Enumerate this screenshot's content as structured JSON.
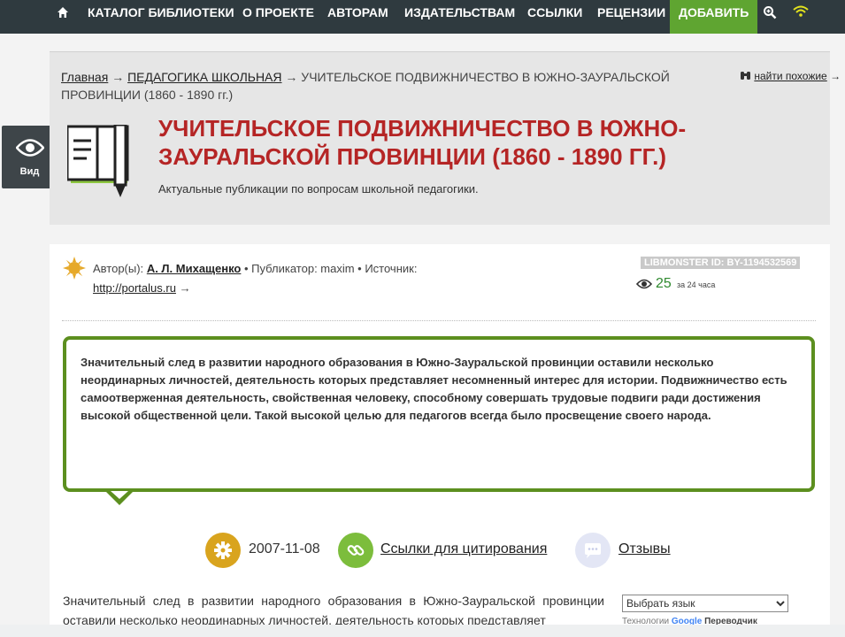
{
  "nav": {
    "items": [
      "КАТАЛОГ БИБЛИОТЕКИ",
      "О ПРОЕКТЕ",
      "АВТОРАМ",
      "ИЗДАТЕЛЬСТВАМ",
      "ССЫЛКИ",
      "РЕЦЕНЗИИ"
    ],
    "add_label": "ДОБАВИТЬ"
  },
  "breadcrumb": {
    "home": "Главная",
    "section": "ПЕДАГОГИКА ШКОЛЬНАЯ",
    "current": "УЧИТЕЛЬСКОЕ ПОДВИЖНИЧЕСТВО В ЮЖНО-ЗАУРАЛЬСКОЙ ПРОВИНЦИИ (1860 - 1890 гг.)"
  },
  "find_similar": "найти похожие",
  "title": "УЧИТЕЛЬСКОЕ ПОДВИЖНИЧЕСТВО В ЮЖНО-ЗАУРАЛЬСКОЙ ПРОВИНЦИИ (1860 - 1890 гг.)",
  "subtitle": "Актуальные публикации по вопросам школьной педагогики.",
  "view_label": "Вид",
  "author": {
    "label": "Автор(ы):",
    "name": "А. Л. Михащенко",
    "publisher": "• Публикатор: maxim • Источник:",
    "source": "http://portalus.ru"
  },
  "libmonster_id": "LIBMONSTER ID: BY-1194532569",
  "views": {
    "count": "25",
    "period": "за 24 часа"
  },
  "abstract": "Значительный след в развитии народного образования в Южно-Зауральской провинции оставили несколько неординарных личностей, деятельность которых представляет несомненный интерес для истории. Подвижничество есть самоотверженная деятельность, свойственная человеку, способному совершать трудовые подвиги ради достижения высокой общественной цели. Такой высокой целью для педагогов всегда было просвещение своего народа.",
  "meta": {
    "date": "2007-11-08",
    "cite_label": "Ссылки для цитирования",
    "reviews_label": "Отзывы"
  },
  "body_text": "Значительный след в развитии народного образования в Южно-Зауральской провинции оставили несколько неординарных личностей, деятельность которых представляет",
  "language": {
    "placeholder": "Выбрать язык",
    "powered_prefix": "Технологии",
    "powered_brand": "Google",
    "powered_product": "Переводчик"
  },
  "colors": {
    "nav_bg": "#2f3a3f",
    "add_bg": "#5fa531",
    "title": "#b52525",
    "abstract_border": "#5c8f1f"
  }
}
